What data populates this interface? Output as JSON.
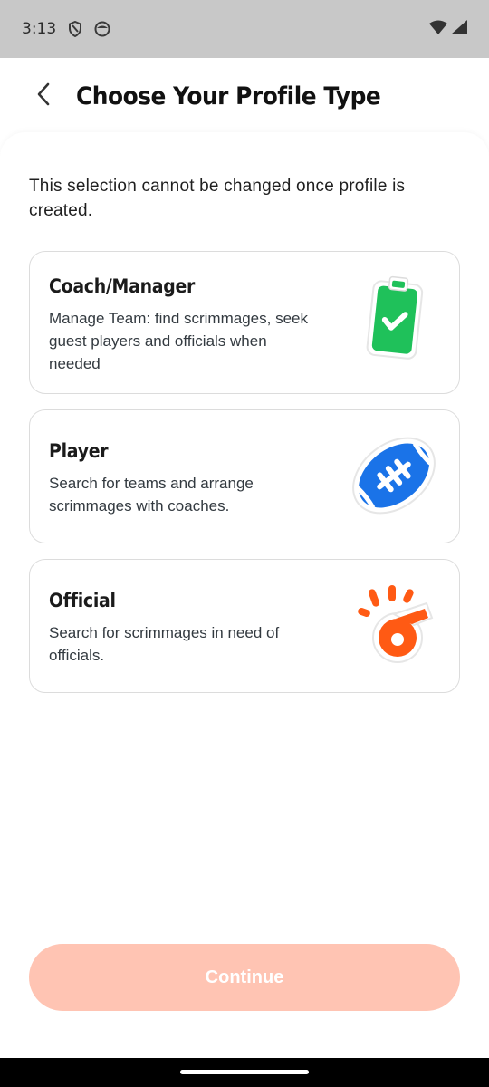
{
  "status": {
    "time": "3:13",
    "icons": [
      "shield-icon",
      "face-icon",
      "wifi-icon",
      "signal-icon"
    ]
  },
  "header": {
    "title": "Choose Your Profile Type",
    "back_icon": "chevron-left-icon"
  },
  "note": "This selection cannot be changed once profile is created.",
  "profiles": [
    {
      "title": "Coach/Manager",
      "description": "Manage Team: find scrimmages, seek guest players and officials when needed",
      "icon": "clipboard-check-icon",
      "color": "#1fc15a"
    },
    {
      "title": "Player",
      "description": "Search for teams and arrange scrimmages with coaches.",
      "icon": "football-icon",
      "color": "#1a73e8"
    },
    {
      "title": "Official",
      "description": "Search for scrimmages in need of officials.",
      "icon": "whistle-icon",
      "color": "#ff5a14"
    }
  ],
  "continue_label": "Continue",
  "colors": {
    "accent_disabled": "#ffc4b3",
    "status_bar": "#c8c8c8"
  }
}
